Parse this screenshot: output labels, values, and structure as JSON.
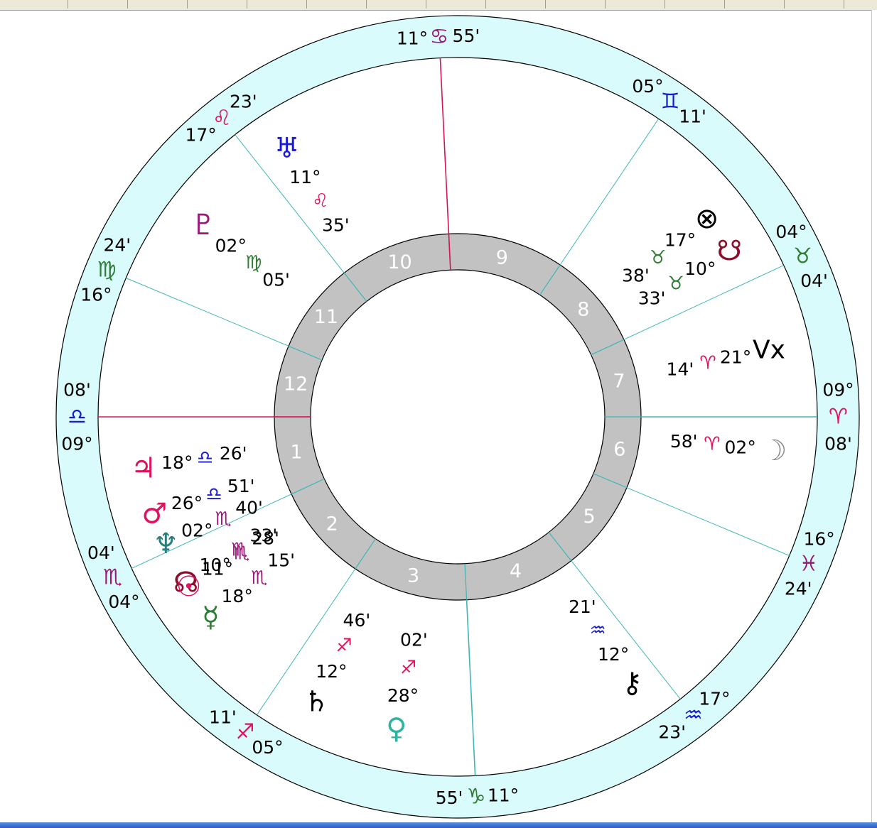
{
  "window": {
    "top_segments": 15
  },
  "colors": {
    "outer_band": "#d9fbfb",
    "house_ring": "#c2c2c2",
    "angle_line": "#d4145a",
    "cusp_line": "#3fb6b6",
    "ring_stroke": "#000000",
    "fire": "#e0115f",
    "earth": "#2e7d32",
    "air": "#1a1ad4",
    "water": "#9c1a7a"
  },
  "chart_data": {
    "type": "natal-wheel",
    "house_numbers": [
      "1",
      "2",
      "3",
      "4",
      "5",
      "6",
      "7",
      "8",
      "9",
      "10",
      "11",
      "12"
    ],
    "cusps": [
      {
        "name": "cusp-ascendant",
        "lon": 189.13,
        "deg": "09°",
        "min": "08'",
        "sign": "libra",
        "glyph": "♎",
        "color": "#1a1ad4"
      },
      {
        "name": "cusp-2",
        "lon": 214.07,
        "deg": "04°",
        "min": "04'",
        "sign": "scorpio",
        "glyph": "♏",
        "color": "#9c1a7a"
      },
      {
        "name": "cusp-3",
        "lon": 245.18,
        "deg": "05°",
        "min": "11'",
        "sign": "sagittarius",
        "glyph": "♐",
        "color": "#e0115f"
      },
      {
        "name": "cusp-ic",
        "lon": 281.92,
        "deg": "11°",
        "min": "55'",
        "sign": "capricorn",
        "glyph": "♑",
        "color": "#2e7d32"
      },
      {
        "name": "cusp-5",
        "lon": 317.38,
        "deg": "17°",
        "min": "23'",
        "sign": "aquarius",
        "glyph": "♒",
        "color": "#1a1ad4"
      },
      {
        "name": "cusp-6",
        "lon": 346.4,
        "deg": "16°",
        "min": "24'",
        "sign": "pisces",
        "glyph": "♓",
        "color": "#9c1a7a"
      },
      {
        "name": "cusp-descendant",
        "lon": 9.13,
        "deg": "09°",
        "min": "08'",
        "sign": "aries",
        "glyph": "♈",
        "color": "#e0115f"
      },
      {
        "name": "cusp-8",
        "lon": 34.07,
        "deg": "04°",
        "min": "04'",
        "sign": "taurus",
        "glyph": "♉",
        "color": "#2e7d32"
      },
      {
        "name": "cusp-9",
        "lon": 65.18,
        "deg": "05°",
        "min": "11'",
        "sign": "gemini",
        "glyph": "♊",
        "color": "#1a1ad4"
      },
      {
        "name": "cusp-mc",
        "lon": 101.92,
        "deg": "11°",
        "min": "55'",
        "sign": "cancer",
        "glyph": "♋",
        "color": "#9c1a7a"
      },
      {
        "name": "cusp-11",
        "lon": 137.38,
        "deg": "17°",
        "min": "23'",
        "sign": "leo",
        "glyph": "♌",
        "color": "#e0115f"
      },
      {
        "name": "cusp-12",
        "lon": 166.4,
        "deg": "16°",
        "min": "24'",
        "sign": "virgo",
        "glyph": "♍",
        "color": "#2e7d32"
      }
    ],
    "planets": [
      {
        "name": "uranus",
        "glyph": "♅",
        "color": "#1a1ad4",
        "lon": 131.58,
        "deg": "11°",
        "min": "35'",
        "sign": "leo",
        "sign_glyph": "♌",
        "sign_color": "#e0115f"
      },
      {
        "name": "pluto",
        "glyph": "♇",
        "color": "#9c1a7a",
        "lon": 152.08,
        "deg": "02°",
        "min": "05'",
        "sign": "virgo",
        "sign_glyph": "♍",
        "sign_color": "#2e7d32"
      },
      {
        "name": "part-of-fortune",
        "glyph": "⊗",
        "color": "#000000",
        "lon": 47.63,
        "deg": "17°",
        "min": "38'",
        "sign": "taurus",
        "sign_glyph": "♉",
        "sign_color": "#2e7d32"
      },
      {
        "name": "south-node",
        "glyph": "☋",
        "color": "#8b0f2a",
        "lon": 40.55,
        "deg": "10°",
        "min": "33'",
        "sign": "taurus",
        "sign_glyph": "♉",
        "sign_color": "#2e7d32"
      },
      {
        "name": "vertex",
        "glyph": "Vx",
        "color": "#000000",
        "lon": 21.23,
        "deg": "21°",
        "min": "14'",
        "sign": "aries",
        "sign_glyph": "♈",
        "sign_color": "#e0115f"
      },
      {
        "name": "moon",
        "glyph": "☽",
        "color": "#8a8a8a",
        "lon": 2.97,
        "deg": "02°",
        "min": "58'",
        "sign": "aries",
        "sign_glyph": "♈",
        "sign_color": "#e0115f"
      },
      {
        "name": "jupiter",
        "glyph": "♃",
        "color": "#e0115f",
        "lon": 198.43,
        "deg": "18°",
        "min": "26'",
        "sign": "libra",
        "sign_glyph": "♎",
        "sign_color": "#1a1ad4"
      },
      {
        "name": "mars",
        "glyph": "♂",
        "color": "#e0115f",
        "lon": 206.85,
        "deg": "26°",
        "min": "51'",
        "sign": "libra",
        "sign_glyph": "♎",
        "sign_color": "#1a1ad4"
      },
      {
        "name": "neptune",
        "glyph": "♆",
        "color": "#2b7d7d",
        "lon": 212.67,
        "deg": "02°",
        "min": "40'",
        "sign": "scorpio",
        "sign_glyph": "♏",
        "sign_color": "#9c1a7a"
      },
      {
        "name": "north-node",
        "glyph": "☊",
        "color": "#8b0f2a",
        "lon": 220.55,
        "deg": "10°",
        "min": "33'",
        "sign": "scorpio",
        "sign_glyph": "♏",
        "sign_color": "#9c1a7a"
      },
      {
        "name": "sun",
        "glyph": "☉",
        "color": "#e0115f",
        "lon": 221.47,
        "deg": "11°",
        "min": "28'",
        "sign": "scorpio",
        "sign_glyph": "♏",
        "sign_color": "#9c1a7a"
      },
      {
        "name": "mercury",
        "glyph": "☿",
        "color": "#2e7d32",
        "lon": 228.25,
        "deg": "18°",
        "min": "15'",
        "sign": "scorpio",
        "sign_glyph": "♏",
        "sign_color": "#9c1a7a"
      },
      {
        "name": "saturn",
        "glyph": "♄",
        "color": "#000000",
        "lon": 252.77,
        "deg": "12°",
        "min": "46'",
        "sign": "sagittarius",
        "sign_glyph": "♐",
        "sign_color": "#e0115f"
      },
      {
        "name": "venus",
        "glyph": "♀",
        "color": "#2bb5a0",
        "lon": 268.03,
        "deg": "28°",
        "min": "02'",
        "sign": "sagittarius",
        "sign_glyph": "♐",
        "sign_color": "#e0115f"
      },
      {
        "name": "chiron",
        "glyph": "⚷",
        "color": "#000000",
        "lon": 312.35,
        "deg": "12°",
        "min": "21'",
        "sign": "aquarius",
        "sign_glyph": "♒",
        "sign_color": "#1a1ad4"
      }
    ]
  }
}
